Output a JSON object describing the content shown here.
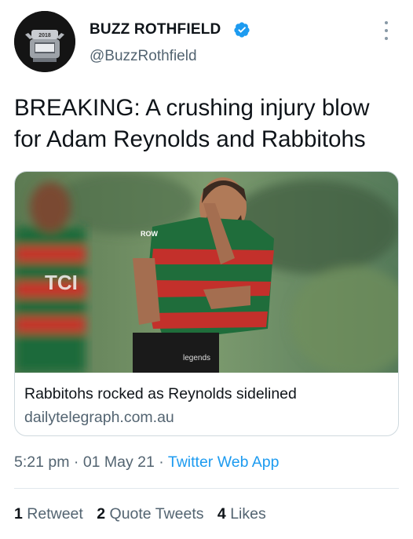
{
  "author": {
    "display_name": "BUZZ ROTHFIELD",
    "handle": "@BuzzRothfield",
    "verified": true,
    "avatar_icon": "nrl-trophy-avatar",
    "avatar_year": "2018"
  },
  "tweet": {
    "text": "BREAKING: A crushing injury blow for Adam Reynolds and Rabbitohs"
  },
  "card": {
    "image_icon": "rugby-player-kicking-photo",
    "title": "Rabbitohs rocked as Reynolds sidelined",
    "domain": "dailytelegraph.com.au"
  },
  "meta": {
    "time": "5:21 pm",
    "separator": "·",
    "date": "01 May 21",
    "source": "Twitter Web App"
  },
  "stats": {
    "retweets_count": "1",
    "retweets_label": "Retweet",
    "quotes_count": "2",
    "quotes_label": "Quote Tweets",
    "likes_count": "4",
    "likes_label": "Likes"
  },
  "colors": {
    "link": "#1d9bf0",
    "secondary_text": "#536471",
    "verified_badge": "#1d9bf0"
  }
}
